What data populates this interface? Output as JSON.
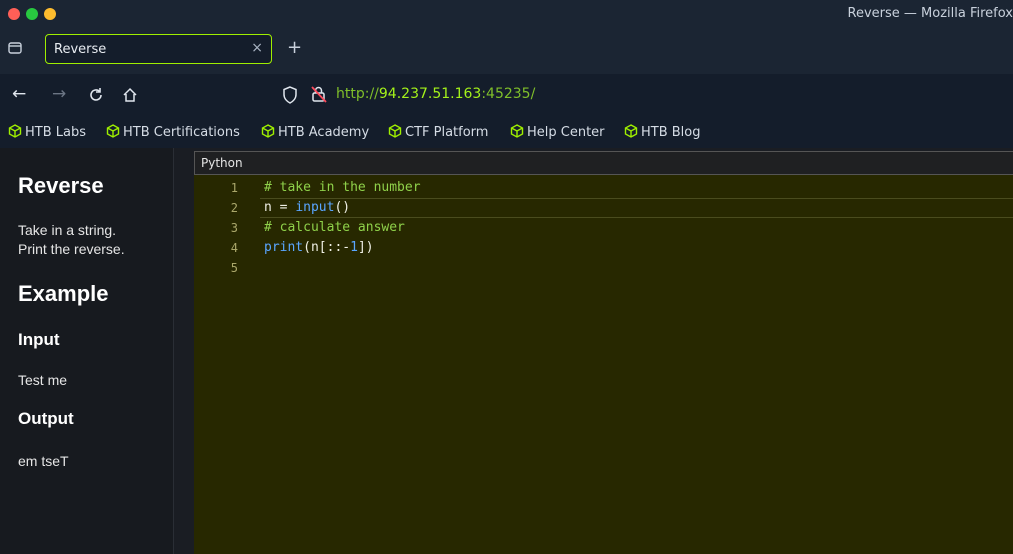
{
  "window": {
    "title": "Reverse — Mozilla Firefox"
  },
  "tab": {
    "label": "Reverse",
    "close": "×",
    "new": "+"
  },
  "nav": {
    "url_scheme": "http://",
    "url_host": "94.237.51.163",
    "url_port": ":45235/"
  },
  "bookmarks": [
    "HTB Labs",
    "HTB Certifications",
    "HTB Academy",
    "CTF Platform",
    "Help Center",
    "HTB Blog"
  ],
  "sidebar": {
    "title": "Reverse",
    "description_1": "Take in a string.",
    "description_2": "Print the reverse.",
    "example_heading": "Example",
    "input_heading": "Input",
    "input_value": "Test me",
    "output_heading": "Output",
    "output_value": "em tseT"
  },
  "editor": {
    "language": "Python",
    "line_numbers": [
      "1",
      "2",
      "3",
      "4",
      "5"
    ],
    "lines": {
      "l1": "# take in the number",
      "l2_a": "n = ",
      "l2_b": "input",
      "l2_c": "()",
      "l3": "# calculate answer",
      "l4_a": "print",
      "l4_b": "(n[::-",
      "l4_c": "1",
      "l4_d": "])"
    }
  },
  "colors": {
    "accent": "#9fef00",
    "editor_bg": "#272800"
  }
}
